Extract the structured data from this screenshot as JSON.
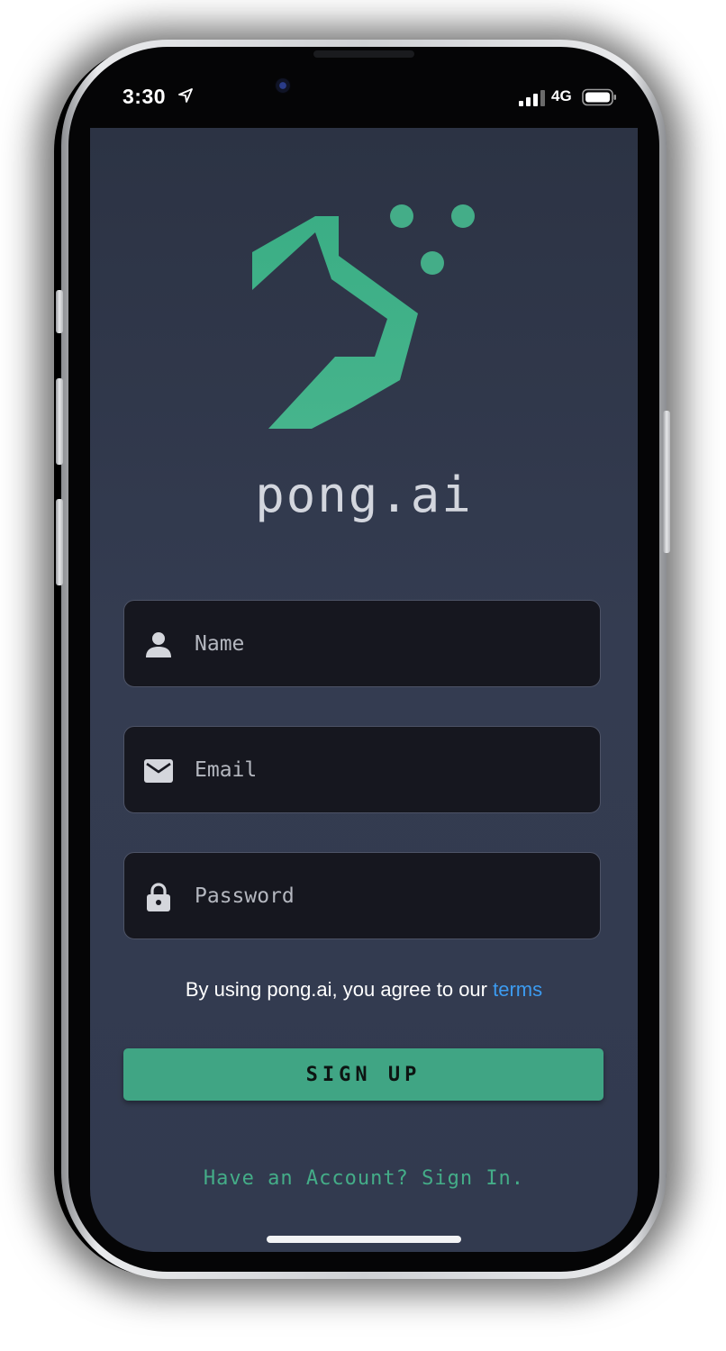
{
  "status_bar": {
    "time": "3:30",
    "network": "4G"
  },
  "app": {
    "name": "pong.ai",
    "brand_color": "#44ad88",
    "background": "#343c51"
  },
  "form": {
    "name_field": {
      "placeholder": "Name",
      "icon": "person-icon"
    },
    "email_field": {
      "placeholder": "Email",
      "icon": "envelope-icon"
    },
    "password_field": {
      "placeholder": "Password",
      "icon": "lock-icon"
    }
  },
  "terms": {
    "prefix": "By using pong.ai, you agree to our ",
    "link_label": "terms",
    "link_color": "#3c9bf0"
  },
  "signup_button": {
    "label": "SIGN UP"
  },
  "signin_link": {
    "label": "Have an Account? Sign In."
  }
}
